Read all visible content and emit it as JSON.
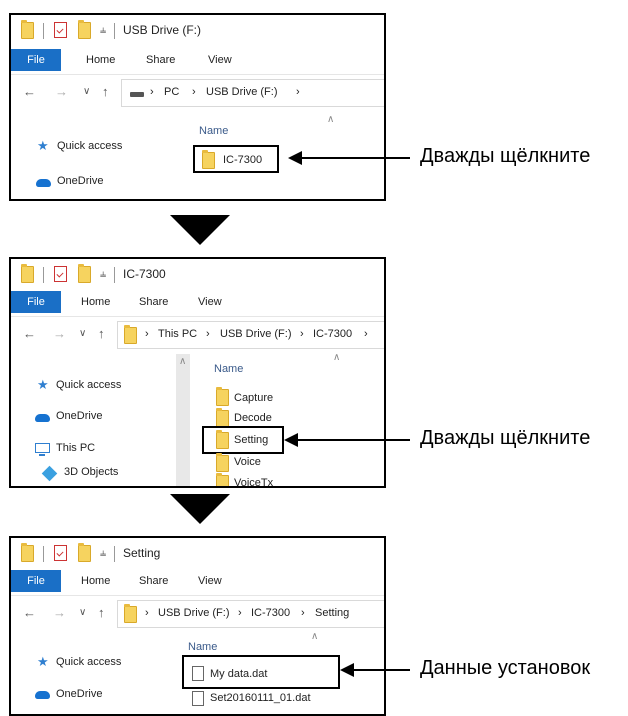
{
  "screens": [
    {
      "window_title": "USB Drive (F:)",
      "ribbon": [
        "File",
        "Home",
        "Share",
        "View"
      ],
      "breadcrumb": [
        "PC",
        "USB Drive (F:)"
      ],
      "sidebar": [
        "Quick access",
        "OneDrive"
      ],
      "column_header": "Name",
      "items": [
        "IC-7300"
      ],
      "highlighted_item": "IC-7300",
      "callout": "Дважды щёлкните"
    },
    {
      "window_title": "IC-7300",
      "ribbon": [
        "File",
        "Home",
        "Share",
        "View"
      ],
      "breadcrumb": [
        "This PC",
        "USB Drive (F:)",
        "IC-7300"
      ],
      "sidebar": [
        "Quick access",
        "OneDrive",
        "This PC",
        "3D Objects"
      ],
      "column_header": "Name",
      "items": [
        "Capture",
        "Decode",
        "Setting",
        "Voice",
        "VoiceTx"
      ],
      "highlighted_item": "Setting",
      "callout": "Дважды щёлкните"
    },
    {
      "window_title": "Setting",
      "ribbon": [
        "File",
        "Home",
        "Share",
        "View"
      ],
      "breadcrumb": [
        "USB Drive (F:)",
        "IC-7300",
        "Setting"
      ],
      "sidebar": [
        "Quick access",
        "OneDrive"
      ],
      "column_header": "Name",
      "items": [
        "My data.dat",
        "Set20160111_01.dat"
      ],
      "highlighted_item": "My data.dat",
      "callout": "Данные установок"
    }
  ],
  "icons": {
    "folder": "folder-icon",
    "file": "file-icon",
    "star": "star-icon",
    "cloud": "cloud-icon",
    "pc": "pc-icon",
    "cube": "3d-objects-icon",
    "drive": "drive-icon"
  },
  "colors": {
    "file_tab": "#1a6fc6",
    "folder": "#f6d35f",
    "nav_icon": "#2f7fd0"
  }
}
